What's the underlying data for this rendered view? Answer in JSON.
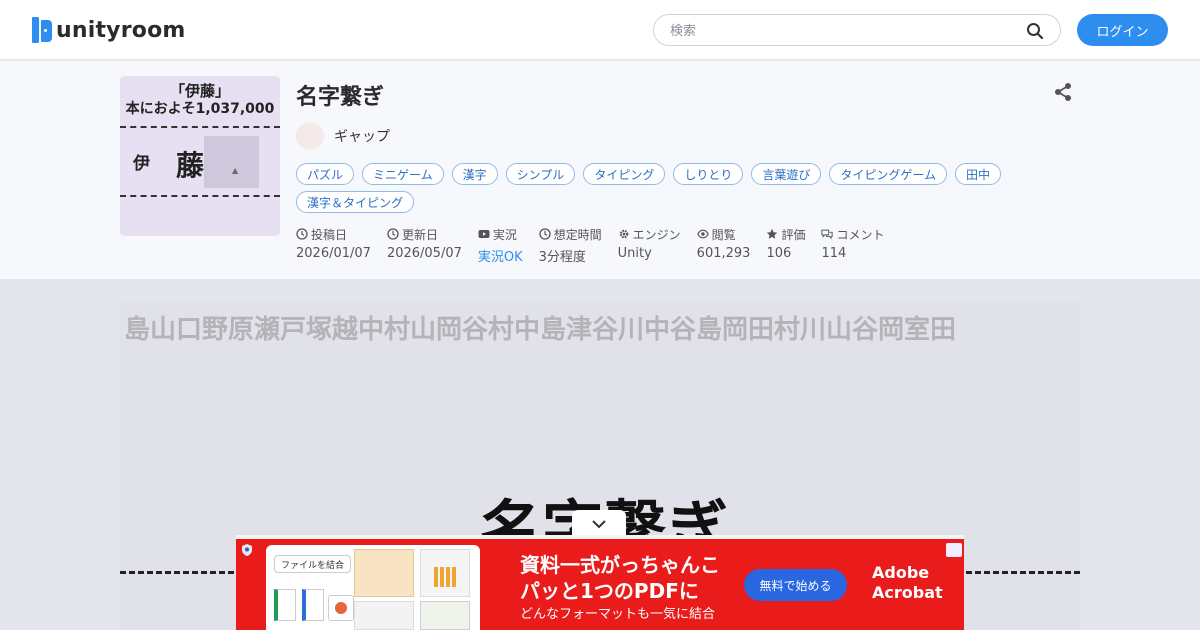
{
  "header": {
    "logo_text": "unityroom",
    "search_placeholder": "検索",
    "login_label": "ログイン"
  },
  "game": {
    "title": "名字繋ぎ",
    "author": "ギャップ",
    "thumbnail": {
      "line1": "「伊藤」",
      "line2": "本におよそ1,037,000",
      "kanji_left": "伊",
      "kanji_right": "藤"
    },
    "tags": [
      "パズル",
      "ミニゲーム",
      "漢字",
      "シンプル",
      "タイピング",
      "しりとり",
      "言葉遊び",
      "タイピングゲーム",
      "田中",
      "漢字＆タイピング"
    ],
    "meta": [
      {
        "label": "投稿日",
        "value": "2026/01/07",
        "icon": "clock-icon"
      },
      {
        "label": "更新日",
        "value": "2026/05/07",
        "icon": "clock-icon"
      },
      {
        "label": "実況",
        "value": "実況OK",
        "icon": "youtube-icon"
      },
      {
        "label": "想定時間",
        "value": "3分程度",
        "icon": "clock-icon"
      },
      {
        "label": "エンジン",
        "value": "Unity",
        "icon": "gear-icon"
      },
      {
        "label": "閲覧",
        "value": "601,293",
        "icon": "eye-icon"
      },
      {
        "label": "評価",
        "value": "106",
        "icon": "star-icon"
      },
      {
        "label": "コメント",
        "value": "114",
        "icon": "comment-icon"
      }
    ]
  },
  "game_screen": {
    "kanji_row": "島山口野原瀬戸塚越中村山岡谷村中島津谷川中谷島岡田村川山谷岡室田",
    "big_title": "名字繋ぎ"
  },
  "ad": {
    "chip_label": "ファイルを結合",
    "headline1": "資料一式がっちゃんこ",
    "headline2": "パッと1つのPDFに",
    "sub": "どんなフォーマットも一気に結合",
    "cta": "無料で始める",
    "brand1": "Adobe",
    "brand2": "Acrobat"
  },
  "colors": {
    "accent": "#2d8ef0",
    "ad_red": "#ea1b1b",
    "ad_button": "#2a66e0"
  }
}
